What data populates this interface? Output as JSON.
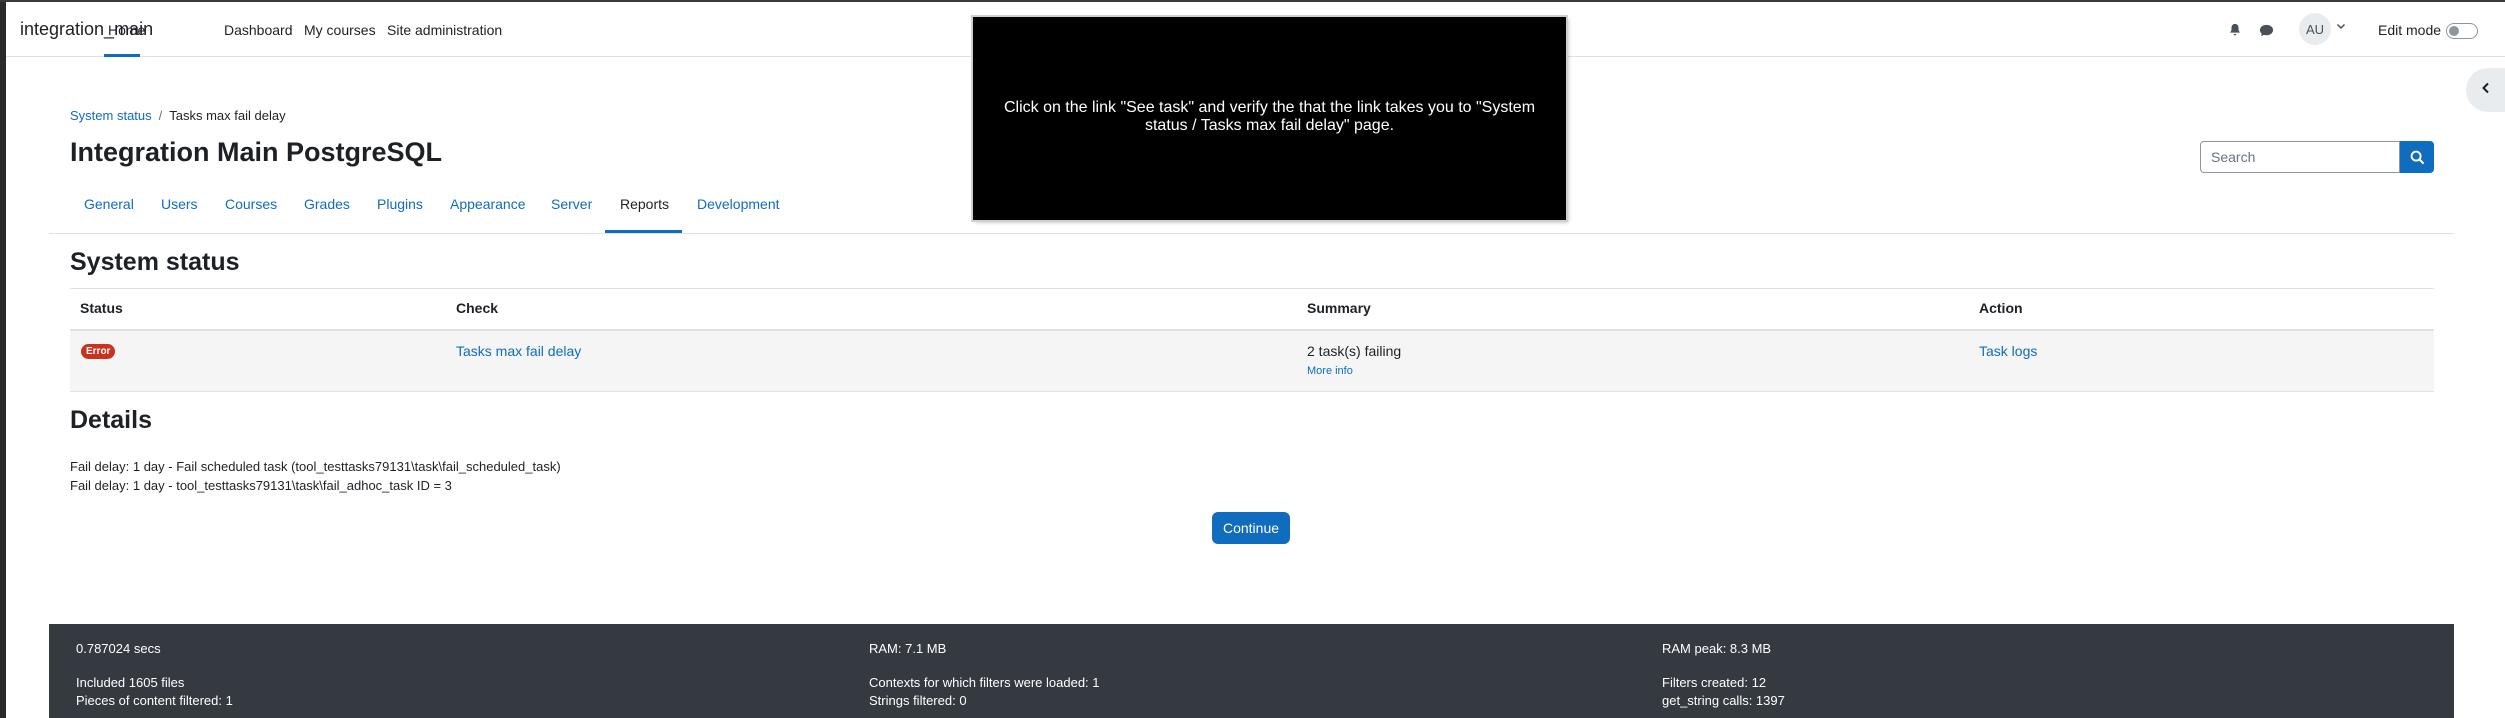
{
  "navbar": {
    "brand": "integration_main",
    "links": [
      "Home",
      "Dashboard",
      "My courses",
      "Site administration"
    ],
    "avatar_initials": "AU",
    "edit_mode_label": "Edit mode",
    "icons": [
      "bell-icon",
      "chat-icon",
      "chevron-down-icon",
      "chevron-left-icon"
    ]
  },
  "breadcrumb": {
    "parent": "System status",
    "separator": "/",
    "current": "Tasks max fail delay"
  },
  "page": {
    "title": "Integration Main PostgreSQL"
  },
  "search": {
    "placeholder": "Search"
  },
  "tabs": [
    "General",
    "Users",
    "Courses",
    "Grades",
    "Plugins",
    "Appearance",
    "Server",
    "Reports",
    "Development"
  ],
  "active_tab": "Reports",
  "system_status": {
    "heading": "System status",
    "columns": [
      "Status",
      "Check",
      "Summary",
      "Action"
    ],
    "row": {
      "status_badge": "Error",
      "check": "Tasks max fail delay",
      "summary": "2 task(s) failing",
      "more_info": "More info",
      "action": "Task logs"
    }
  },
  "details": {
    "heading": "Details",
    "lines": [
      "Fail delay: 1 day - Fail scheduled task (tool_testtasks79131\\task\\fail_scheduled_task)",
      "Fail delay: 1 day - tool_testtasks79131\\task\\fail_adhoc_task ID = 3"
    ]
  },
  "continue_label": "Continue",
  "footer": {
    "col1": [
      "0.787024 secs",
      "Included 1605 files",
      "Pieces of content filtered: 1"
    ],
    "col2": [
      "RAM: 7.1 MB",
      "Contexts for which filters were loaded: 1",
      "Strings filtered: 0"
    ],
    "col3": [
      "RAM peak: 8.3 MB",
      "Filters created: 12",
      "get_string calls: 1397"
    ]
  },
  "overlay": {
    "instruction": "Click on the link \"See task\" and verify the that the link takes you to \"System status / Tasks max fail delay\" page."
  },
  "colors": {
    "primary": "#0f6cbf",
    "error_badge": "#ca3120",
    "footer_bg": "#343a40"
  }
}
